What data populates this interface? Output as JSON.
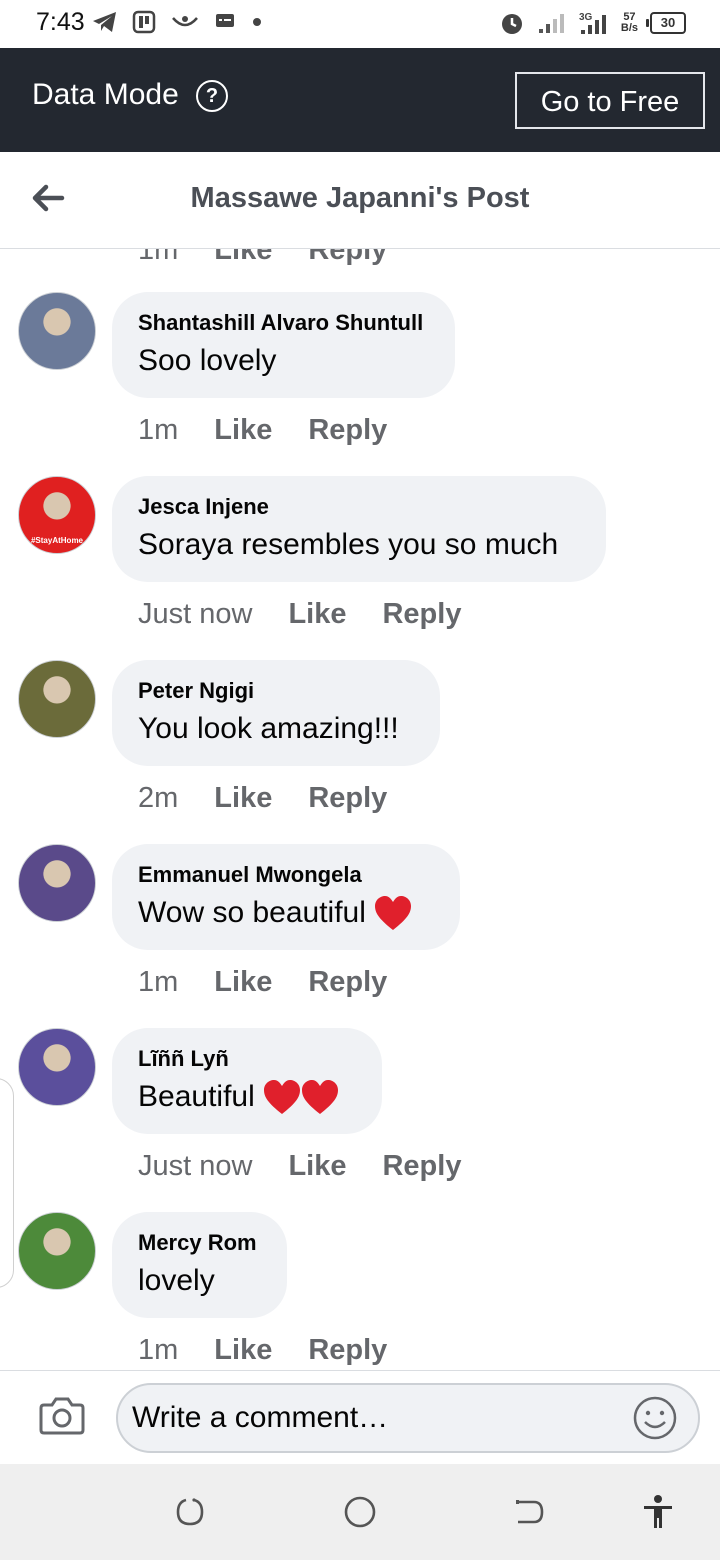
{
  "status_bar": {
    "time": "7:43",
    "net_speed_value": "57",
    "net_speed_unit": "B/s",
    "battery": "30",
    "signal": "3G"
  },
  "data_mode": {
    "label": "Data Mode",
    "help": "?",
    "go_free_label": "Go to Free"
  },
  "header": {
    "title": "Massawe Japanni's Post"
  },
  "previous_comment_meta": {
    "time": "1m",
    "like": "Like",
    "reply": "Reply"
  },
  "comments": [
    {
      "author": "Shantashill Alvaro Shuntull",
      "text": "Soo lovely",
      "time": "1m",
      "like": "Like",
      "reply": "Reply",
      "hearts": 0,
      "avatar_color": "#6b7a99"
    },
    {
      "author": "Jesca Injene",
      "text": "Soraya resembles you so much",
      "time": "Just now",
      "like": "Like",
      "reply": "Reply",
      "hearts": 0,
      "avatar_color": "#e02020",
      "avatar_badge": "#StayAtHome"
    },
    {
      "author": "Peter Ngigi",
      "text": "You look amazing!!!",
      "time": "2m",
      "like": "Like",
      "reply": "Reply",
      "hearts": 0,
      "avatar_color": "#6b6b3a"
    },
    {
      "author": "Emmanuel Mwongela",
      "text": "Wow so beautiful ",
      "time": "1m",
      "like": "Like",
      "reply": "Reply",
      "hearts": 1,
      "avatar_color": "#5a4a8a"
    },
    {
      "author": "Lĩññ Lyñ",
      "text": "Beautiful ",
      "time": "Just now",
      "like": "Like",
      "reply": "Reply",
      "hearts": 2,
      "avatar_color": "#5b4f9c"
    },
    {
      "author": "Mercy Rom",
      "text": "lovely",
      "time": "1m",
      "like": "Like",
      "reply": "Reply",
      "hearts": 0,
      "avatar_color": "#4d8a3a"
    }
  ],
  "composer": {
    "placeholder": "Write a comment…"
  },
  "colors": {
    "data_bar_bg": "#232830",
    "bubble_bg": "#f0f2f5",
    "meta_text": "#65676b",
    "heart": "#e0202c"
  }
}
